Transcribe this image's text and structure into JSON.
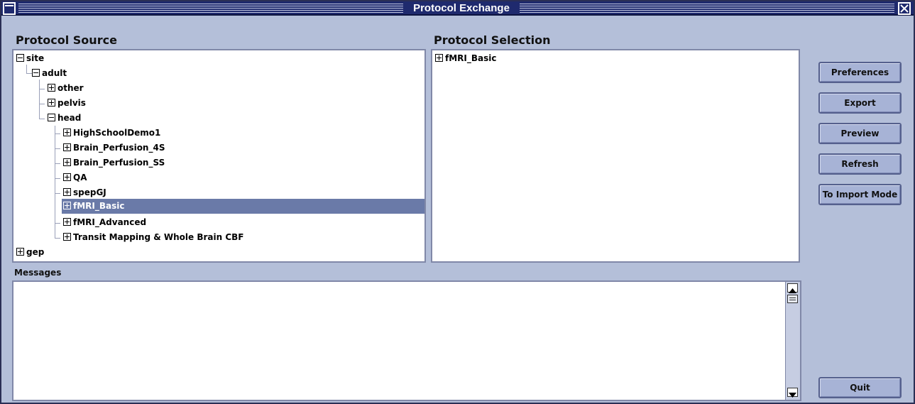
{
  "window": {
    "title": "Protocol Exchange"
  },
  "source_panel": {
    "header": "Protocol Source",
    "tree": [
      {
        "label": "site",
        "expanded": true
      },
      {
        "label": "adult",
        "expanded": true
      },
      {
        "label": "other",
        "expanded": false
      },
      {
        "label": "pelvis",
        "expanded": false
      },
      {
        "label": "head",
        "expanded": true
      },
      {
        "label": "HighSchoolDemo1",
        "expanded": false
      },
      {
        "label": "Brain_Perfusion_4S",
        "expanded": false
      },
      {
        "label": "Brain_Perfusion_SS",
        "expanded": false
      },
      {
        "label": "QA",
        "expanded": false
      },
      {
        "label": "spepGJ",
        "expanded": false
      },
      {
        "label": "fMRI_Basic",
        "expanded": false,
        "selected": true
      },
      {
        "label": "fMRI_Advanced",
        "expanded": false
      },
      {
        "label": "Transit Mapping & Whole Brain CBF",
        "expanded": false
      },
      {
        "label": "gep",
        "expanded": false
      }
    ]
  },
  "selection_panel": {
    "header": "Protocol Selection",
    "tree": [
      {
        "label": "fMRI_Basic",
        "expanded": false
      }
    ]
  },
  "buttons": {
    "preferences": "Preferences",
    "export": "Export",
    "preview": "Preview",
    "refresh": "Refresh",
    "import_mode": "To Import Mode",
    "quit": "Quit"
  },
  "messages": {
    "label": "Messages",
    "text": ""
  },
  "colors": {
    "titlebar": "#1f2a6e",
    "background": "#b4bfd9",
    "selection": "#6a7aa8"
  }
}
